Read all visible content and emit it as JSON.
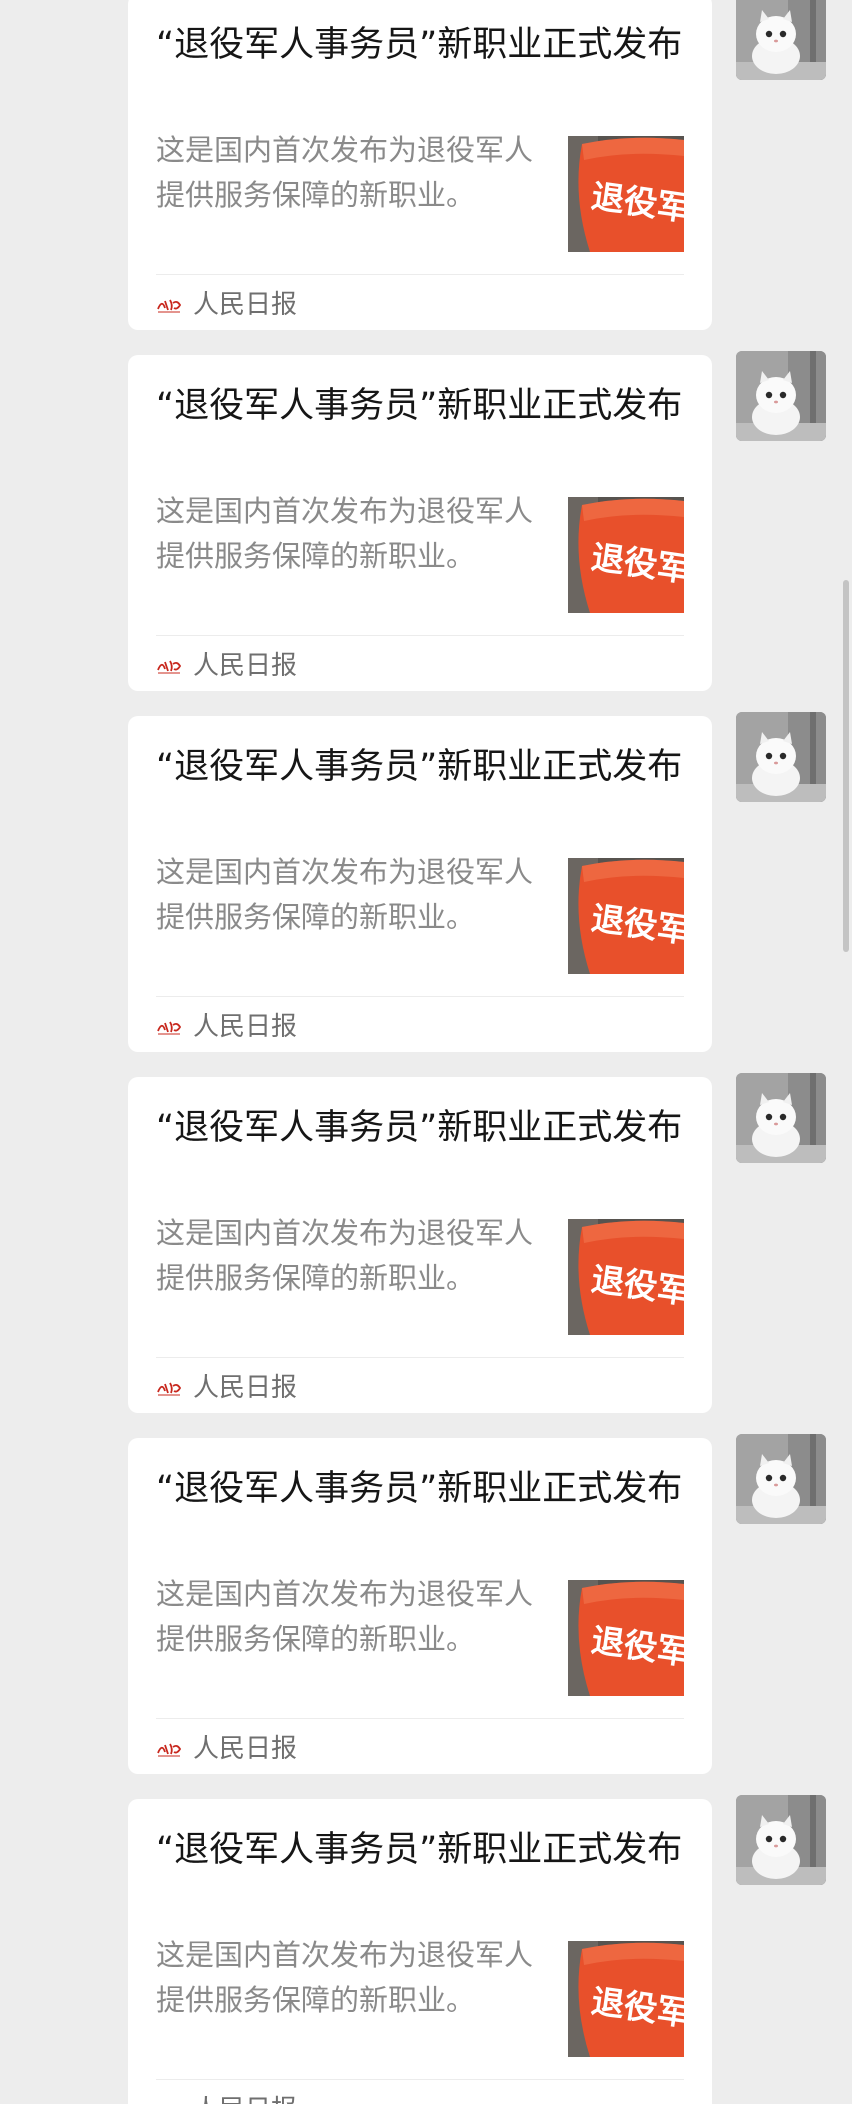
{
  "messages": [
    {
      "title": "“退役军人事务员”新职业正式发布",
      "description": "这是国内首次发布为退役军人提供服务保障的新职业。",
      "source": "人民日报",
      "thumbnail_text": "退役军人"
    },
    {
      "title": "“退役军人事务员”新职业正式发布",
      "description": "这是国内首次发布为退役军人提供服务保障的新职业。",
      "source": "人民日报",
      "thumbnail_text": "退役军人"
    },
    {
      "title": "“退役军人事务员”新职业正式发布",
      "description": "这是国内首次发布为退役军人提供服务保障的新职业。",
      "source": "人民日报",
      "thumbnail_text": "退役军人"
    },
    {
      "title": "“退役军人事务员”新职业正式发布",
      "description": "这是国内首次发布为退役军人提供服务保障的新职业。",
      "source": "人民日报",
      "thumbnail_text": "退役军人"
    },
    {
      "title": "“退役军人事务员”新职业正式发布",
      "description": "这是国内首次发布为退役军人提供服务保障的新职业。",
      "source": "人民日报",
      "thumbnail_text": "退役军人"
    },
    {
      "title": "“退役军人事务员”新职业正式发布",
      "description": "这是国内首次发布为退役军人提供服务保障的新职业。",
      "source": "人民日报",
      "thumbnail_text": "退役军人"
    }
  ],
  "colors": {
    "background": "#ededed",
    "card": "#ffffff",
    "title_text": "#161616",
    "description_text": "#8a8a8a",
    "source_text": "#6f6f6f",
    "thumbnail_armband": "#e8502b",
    "source_logo": "#c8281e"
  },
  "icons": {
    "source_logo": "people-daily-logo",
    "avatar": "white-kitten-avatar",
    "thumbnail": "red-armband-photo"
  }
}
